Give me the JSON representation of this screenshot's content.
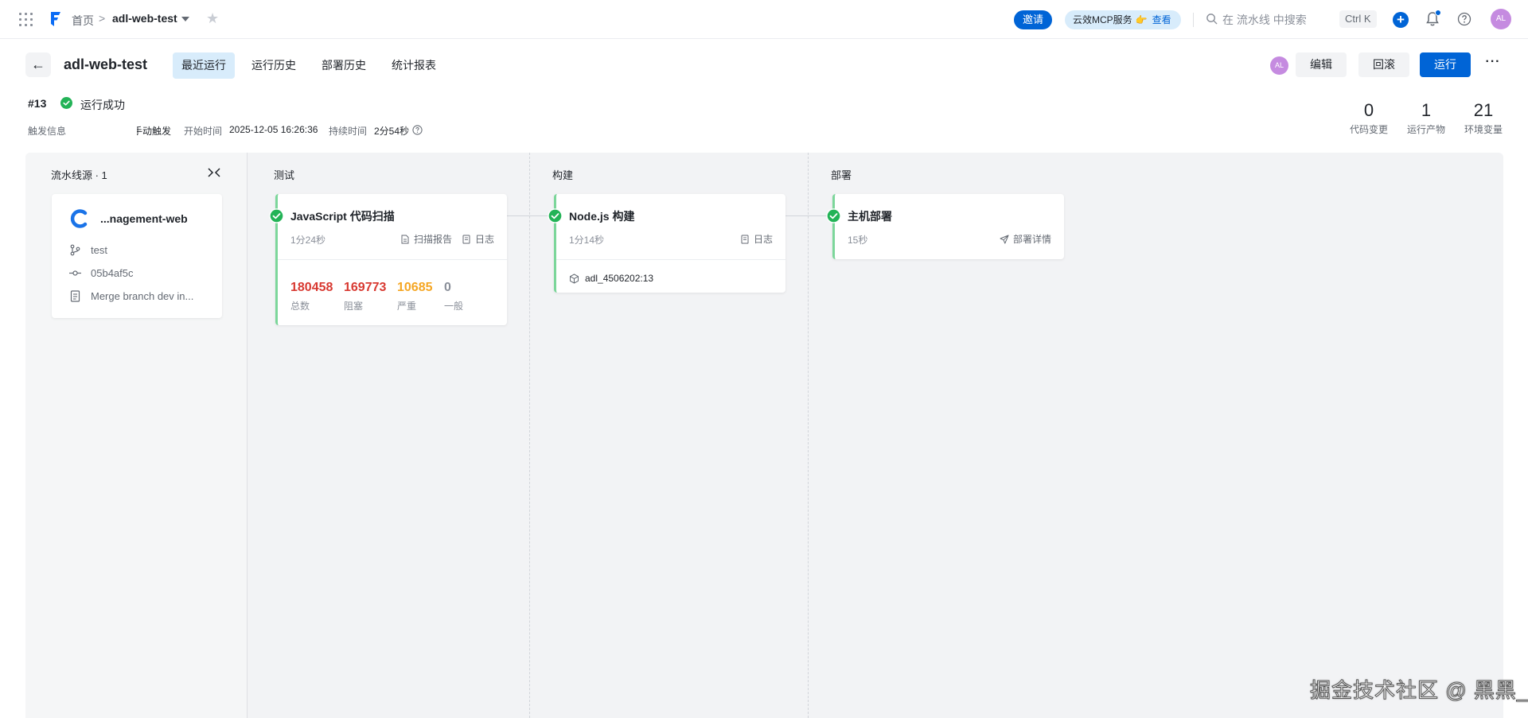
{
  "topbar": {
    "breadcrumb_home": "首页",
    "breadcrumb_sep": ">",
    "breadcrumb_current": "adl-web-test",
    "invite_label": "邀请",
    "mcp_label": "云效MCP服务",
    "mcp_view_label": "查看",
    "search_placeholder": "在 流水线 中搜索",
    "shortcut": "Ctrl K",
    "plus_label": "+",
    "avatar_initials": "AL",
    "icons": [
      "apps-grid-icon",
      "logo-icon",
      "star-icon",
      "search-icon",
      "bell-icon",
      "help-icon"
    ]
  },
  "header": {
    "back_label": "←",
    "pipeline_title": "adl-web-test",
    "tabs": [
      {
        "label": "最近运行",
        "active": true
      },
      {
        "label": "运行历史",
        "active": false
      },
      {
        "label": "部署历史",
        "active": false
      },
      {
        "label": "统计报表",
        "active": false
      }
    ],
    "avatar_initials": "AL",
    "edit_label": "编辑",
    "rollback_label": "回滚",
    "run_label": "运行",
    "more_label": "···"
  },
  "run": {
    "number": "#13",
    "status": "运行成功",
    "trigger_label": "触发信息",
    "trigger_value": "手动触发",
    "start_label": "开始时间",
    "start_value": "2025-12-05 16:26:36",
    "duration_label": "持续时间",
    "duration_value": "2分54秒",
    "stats": [
      {
        "value": "0",
        "label": "代码变更"
      },
      {
        "value": "1",
        "label": "运行产物"
      },
      {
        "value": "21",
        "label": "环境变量"
      }
    ]
  },
  "source": {
    "heading": "流水线源 · 1",
    "repo_name": "...nagement-web",
    "branch": "test",
    "commit": "05b4af5c",
    "message": "Merge branch dev in..."
  },
  "stages": [
    {
      "name": "测试",
      "jobs": [
        {
          "title": "JavaScript 代码扫描",
          "duration": "1分24秒",
          "links": [
            "扫描报告",
            "日志"
          ],
          "scan_stats": [
            {
              "value": "180458",
              "label": "总数",
              "color": "#d83931"
            },
            {
              "value": "169773",
              "label": "阻塞",
              "color": "#d83931"
            },
            {
              "value": "10685",
              "label": "严重",
              "color": "#f5a623"
            },
            {
              "value": "0",
              "label": "一般",
              "color": "#8a8f99"
            }
          ]
        }
      ]
    },
    {
      "name": "构建",
      "jobs": [
        {
          "title": "Node.js 构建",
          "duration": "1分14秒",
          "links": [
            "日志"
          ],
          "artifact": "adl_4506202:13"
        }
      ]
    },
    {
      "name": "部署",
      "jobs": [
        {
          "title": "主机部署",
          "duration": "15秒",
          "links": [
            "部署详情"
          ]
        }
      ]
    }
  ],
  "watermark": "掘金技术社区 @ 黑黑_",
  "colors": {
    "primary": "#0064d6",
    "success": "#23b357",
    "job_accent": "#7cd69a",
    "danger": "#d83931",
    "warning": "#f5a623"
  }
}
